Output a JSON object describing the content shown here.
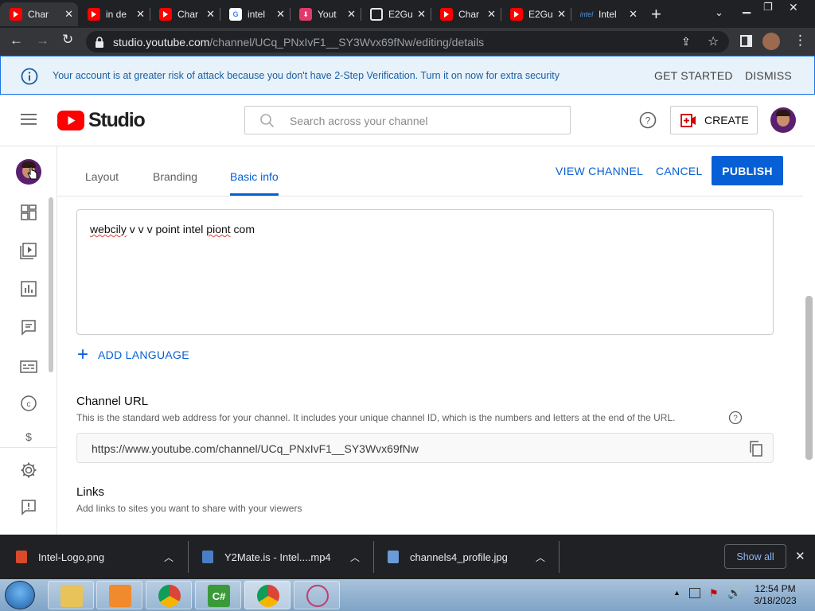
{
  "browser": {
    "tabs": [
      {
        "label": "Char",
        "favicon": "youtube-icon",
        "active": true
      },
      {
        "label": "in de",
        "favicon": "youtube-icon"
      },
      {
        "label": "Char",
        "favicon": "youtube-icon"
      },
      {
        "label": "intel",
        "favicon": "google-icon"
      },
      {
        "label": "Yout",
        "favicon": "download-icon"
      },
      {
        "label": "E2Gu",
        "favicon": "globe-icon"
      },
      {
        "label": "Char",
        "favicon": "youtube-icon"
      },
      {
        "label": "E2Gu",
        "favicon": "youtube-icon"
      },
      {
        "label": "Intel",
        "favicon": "intel-icon"
      }
    ],
    "url_host": "studio.youtube.com",
    "url_path": "/channel/UCq_PNxIvF1__SY3Wvx69fNw/editing/details"
  },
  "banner": {
    "message": "Your account is at greater risk of attack because you don't have 2-Step Verification. Turn it on now for extra security",
    "get_started": "GET STARTED",
    "dismiss": "DISMISS"
  },
  "header": {
    "logo_text": "Studio",
    "search_placeholder": "Search across your channel",
    "create_label": "CREATE"
  },
  "tabs": {
    "layout": "Layout",
    "branding": "Branding",
    "basic_info": "Basic info"
  },
  "actions": {
    "view_channel": "VIEW CHANNEL",
    "cancel": "CANCEL",
    "publish": "PUBLISH"
  },
  "description": {
    "w1": "webcily",
    "w2": " v v v point intel ",
    "w3": "piont",
    "w4": " com"
  },
  "add_language": "ADD LANGUAGE",
  "channel_url": {
    "title": "Channel URL",
    "description": "This is the standard web address for your channel. It includes your unique channel ID, which is the numbers and letters at the end of the URL.",
    "value": "https://www.youtube.com/channel/UCq_PNxIvF1__SY3Wvx69fNw"
  },
  "links": {
    "title": "Links",
    "description": "Add links to sites you want to share with your viewers"
  },
  "downloads": [
    {
      "name": "Intel-Logo.png"
    },
    {
      "name": "Y2Mate.is - Intel....mp4"
    },
    {
      "name": "channels4_profile.jpg"
    }
  ],
  "downloads_show_all": "Show all",
  "clock": {
    "time": "12:54 PM",
    "date": "3/18/2023"
  },
  "colors": {
    "accent": "#065fd4",
    "publish_bg": "#065fd4",
    "youtube_red": "#ff0000"
  }
}
